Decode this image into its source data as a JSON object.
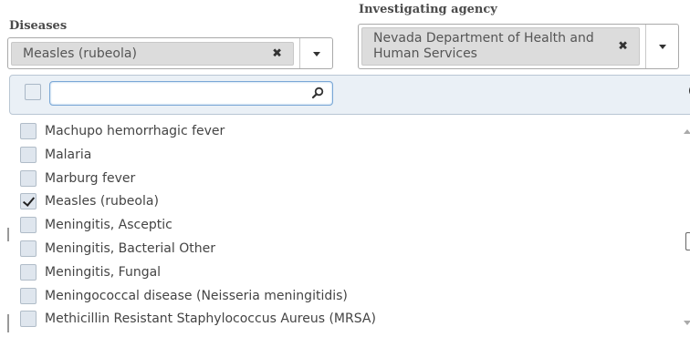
{
  "diseases": {
    "label": "Diseases",
    "selected": "Measles (rubeola)",
    "remove_symbol": "✖"
  },
  "agency": {
    "label": "Investigating agency",
    "selected_line1": "Nevada Department of Health and",
    "selected_line2": "Human Services",
    "remove_symbol": "✖"
  },
  "dropdown": {
    "search_value": "",
    "items": [
      {
        "label": "Machupo hemorrhagic fever",
        "checked": false
      },
      {
        "label": "Malaria",
        "checked": false
      },
      {
        "label": "Marburg fever",
        "checked": false
      },
      {
        "label": "Measles (rubeola)",
        "checked": true
      },
      {
        "label": "Meningitis, Asceptic",
        "checked": false
      },
      {
        "label": "Meningitis, Bacterial Other",
        "checked": false
      },
      {
        "label": "Meningitis, Fungal",
        "checked": false
      },
      {
        "label": "Meningococcal disease (Neisseria meningitidis)",
        "checked": false
      },
      {
        "label": "Methicillin Resistant Staphylococcus Aureus (MRSA)",
        "checked": false
      }
    ]
  },
  "colors": {
    "header_bg": "#eaf0f6",
    "token_bg": "#dcdcdc",
    "search_border": "#7aa7d6"
  }
}
